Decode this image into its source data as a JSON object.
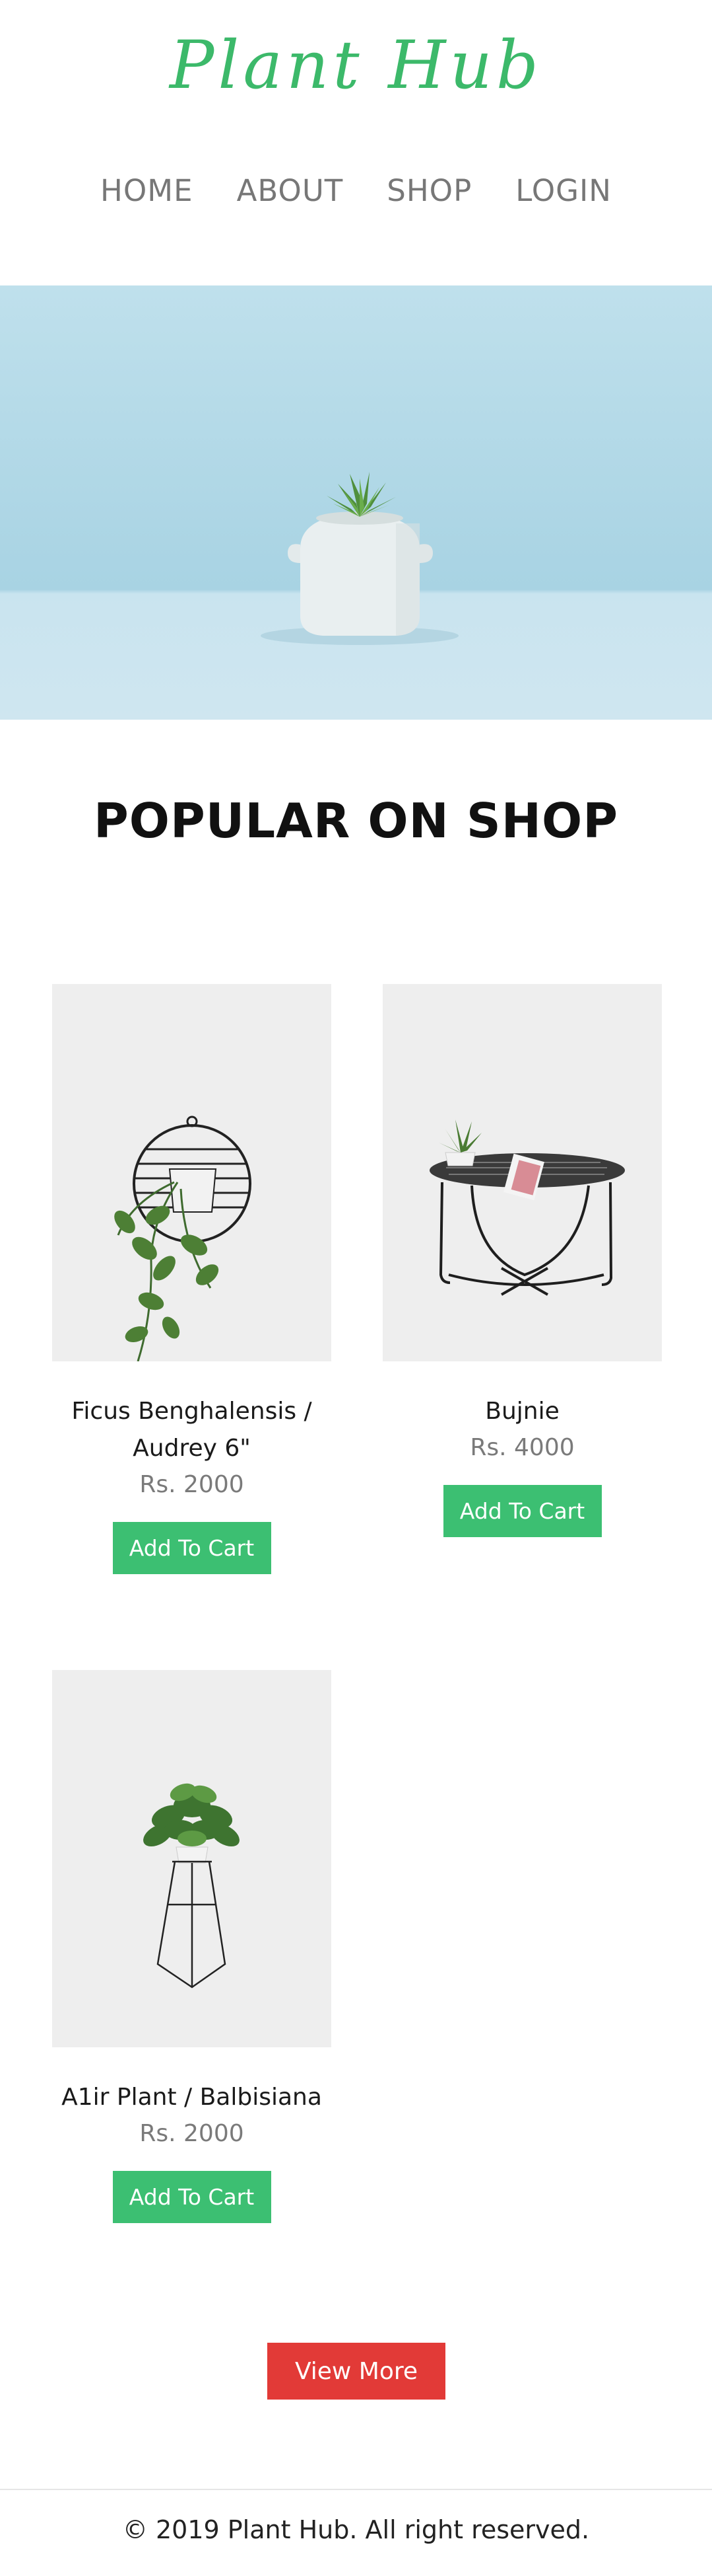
{
  "brand": {
    "logo_text": "Plant Hub",
    "accent_color": "#3cb96a"
  },
  "nav": {
    "items": [
      {
        "label": "HOME"
      },
      {
        "label": "ABOUT"
      },
      {
        "label": "SHOP"
      },
      {
        "label": "LOGIN"
      }
    ]
  },
  "hero": {
    "image": "potted-succulent-photo"
  },
  "section": {
    "title": "POPULAR ON SHOP"
  },
  "products": [
    {
      "name": "Ficus Benghalensis / Audrey 6\"",
      "price": "Rs. 2000",
      "button_label": "Add To Cart",
      "image": "hanging-ring-planter-photo"
    },
    {
      "name": "Bujnie",
      "price": "Rs. 4000",
      "button_label": "Add To Cart",
      "image": "wire-table-with-plant-photo"
    },
    {
      "name": "A1ir Plant / Balbisiana",
      "price": "Rs. 2000",
      "button_label": "Add To Cart",
      "image": "plant-on-stand-photo"
    }
  ],
  "actions": {
    "view_more_label": "View More",
    "cart_button_color": "#3cbf72",
    "view_more_color": "#e23a37"
  },
  "footer": {
    "text": "© 2019 Plant Hub. All right reserved."
  }
}
